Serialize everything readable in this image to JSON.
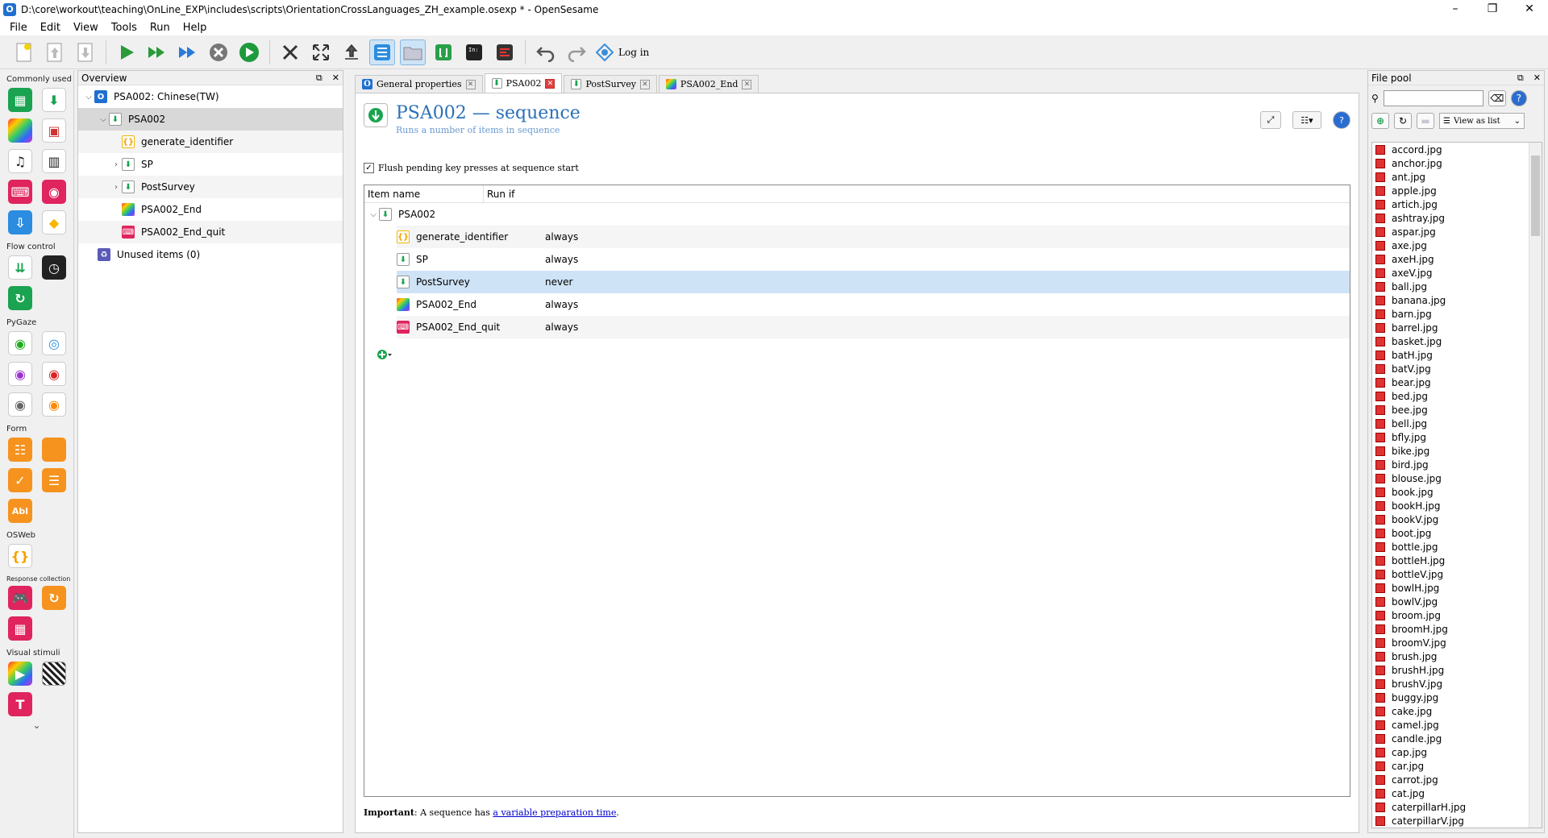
{
  "window": {
    "title": "D:\\core\\workout\\teaching\\OnLine_EXP\\includes\\scripts\\OrientationCrossLanguages_ZH_example.osexp * - OpenSesame",
    "app_icon": "O",
    "minimize": "–",
    "maximize": "❐",
    "close": "✕"
  },
  "menu": [
    "File",
    "Edit",
    "View",
    "Tools",
    "Run",
    "Help"
  ],
  "toolbar": {
    "login_label": "Log in"
  },
  "item_toolbar": {
    "categories": {
      "common": "Commonly used",
      "flow": "Flow control",
      "pygaze": "PyGaze",
      "form": "Form",
      "osweb": "OSWeb",
      "response": "Response collection",
      "visual": "Visual stimuli"
    },
    "more": "⌄"
  },
  "overview": {
    "title": "Overview",
    "root": "PSA002: Chinese(TW)",
    "items": [
      {
        "label": "PSA002",
        "indent": 1
      },
      {
        "label": "generate_identifier",
        "indent": 2
      },
      {
        "label": "SP",
        "indent": 2
      },
      {
        "label": "PostSurvey",
        "indent": 2
      },
      {
        "label": "PSA002_End",
        "indent": 2
      },
      {
        "label": "PSA002_End_quit",
        "indent": 2
      }
    ],
    "unused": "Unused items (0)"
  },
  "tabs": [
    {
      "label": "General properties"
    },
    {
      "label": "PSA002"
    },
    {
      "label": "PostSurvey"
    },
    {
      "label": "PSA002_End"
    }
  ],
  "editor": {
    "title": "PSA002 — sequence",
    "subtitle": "Runs a number of items in sequence",
    "flush_label": "Flush pending key presses at sequence start",
    "flush_checked": true,
    "col_name": "Item name",
    "col_runif": "Run if",
    "root_item": "PSA002",
    "rows": [
      {
        "name": "generate_identifier",
        "runif": "always"
      },
      {
        "name": "SP",
        "runif": "always"
      },
      {
        "name": "PostSurvey",
        "runif": "never"
      },
      {
        "name": "PSA002_End",
        "runif": "always"
      },
      {
        "name": "PSA002_End_quit",
        "runif": "always"
      }
    ],
    "note_bold": "Important",
    "note_text": ": A sequence has ",
    "note_link": "a variable preparation time",
    "note_end": "."
  },
  "filepool": {
    "title": "File pool",
    "view_label": "View as list",
    "files": [
      "accord.jpg",
      "anchor.jpg",
      "ant.jpg",
      "apple.jpg",
      "artich.jpg",
      "ashtray.jpg",
      "aspar.jpg",
      "axe.jpg",
      "axeH.jpg",
      "axeV.jpg",
      "ball.jpg",
      "banana.jpg",
      "barn.jpg",
      "barrel.jpg",
      "basket.jpg",
      "batH.jpg",
      "batV.jpg",
      "bear.jpg",
      "bed.jpg",
      "bee.jpg",
      "bell.jpg",
      "bfly.jpg",
      "bike.jpg",
      "bird.jpg",
      "blouse.jpg",
      "book.jpg",
      "bookH.jpg",
      "bookV.jpg",
      "boot.jpg",
      "bottle.jpg",
      "bottleH.jpg",
      "bottleV.jpg",
      "bowlH.jpg",
      "bowlV.jpg",
      "broom.jpg",
      "broomH.jpg",
      "broomV.jpg",
      "brush.jpg",
      "brushH.jpg",
      "brushV.jpg",
      "buggy.jpg",
      "cake.jpg",
      "camel.jpg",
      "candle.jpg",
      "cap.jpg",
      "car.jpg",
      "carrot.jpg",
      "cat.jpg",
      "caterpillarH.jpg",
      "caterpillarV.jpg"
    ]
  }
}
